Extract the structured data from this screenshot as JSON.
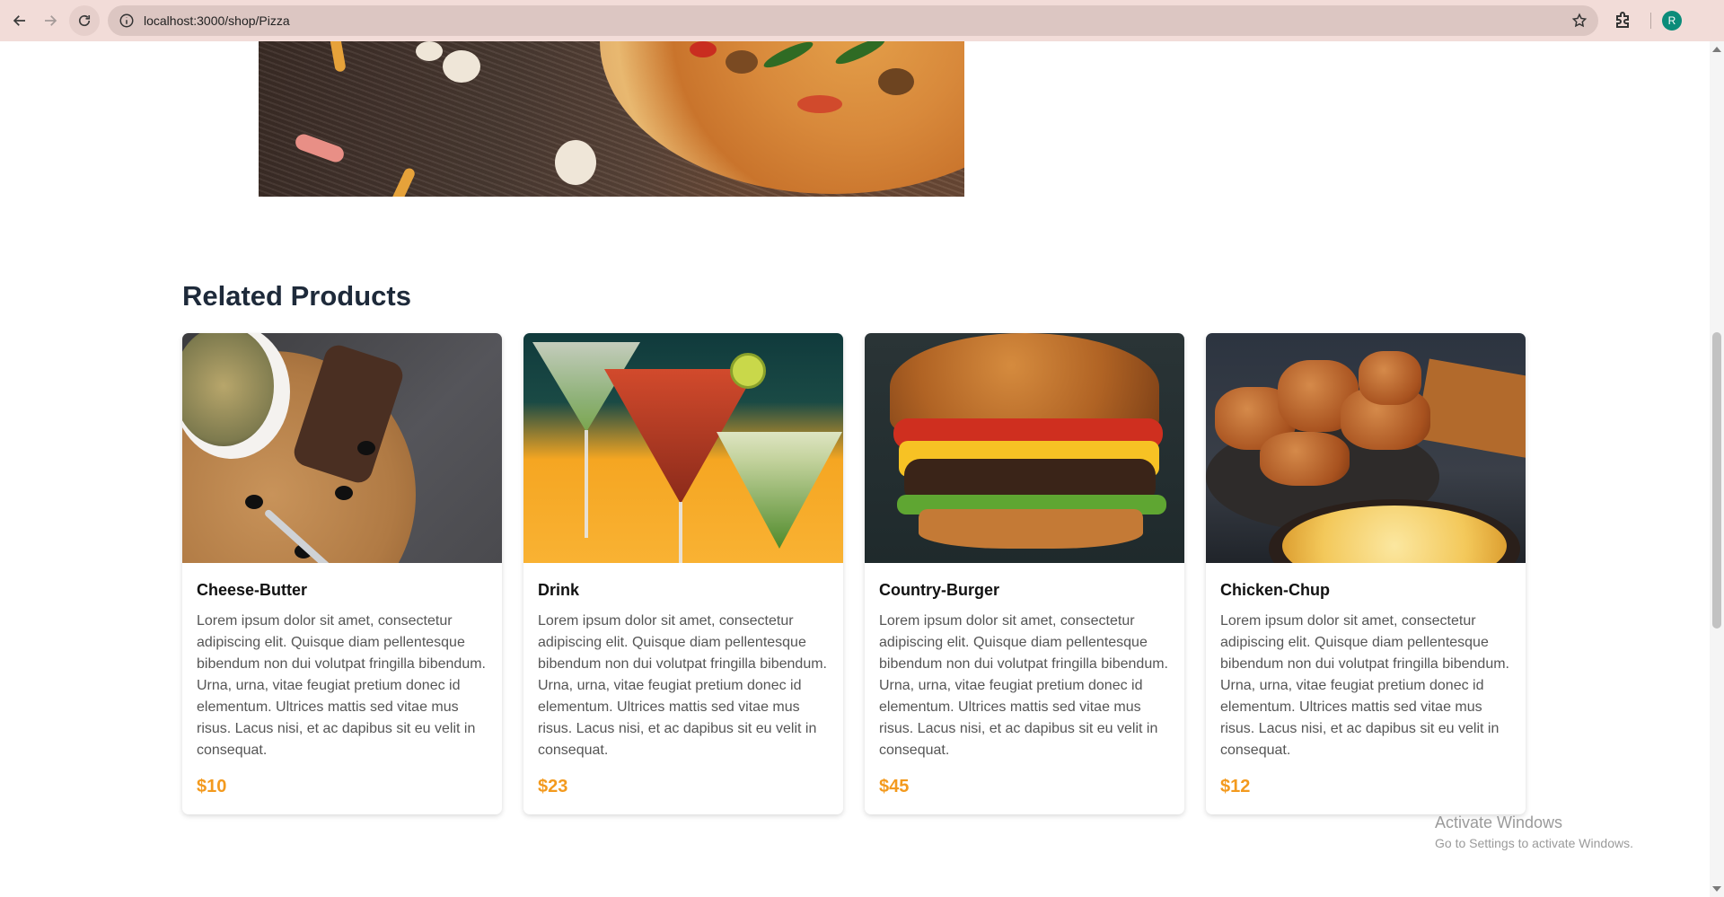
{
  "browser": {
    "url": "localhost:3000/shop/Pizza",
    "avatar_initial": "R",
    "avatar_color": "#0b8c7a"
  },
  "related": {
    "title": "Related Products",
    "products": [
      {
        "name": "Cheese-Butter",
        "description": "Lorem ipsum dolor sit amet, consectetur adipiscing elit. Quisque diam pellentesque bibendum non dui volutpat fringilla bibendum. Urna, urna, vitae feugiat pretium donec id elementum. Ultrices mattis sed vitae mus risus. Lacus nisi, et ac dapibus sit eu velit in consequat.",
        "price": "$10"
      },
      {
        "name": "Drink",
        "description": "Lorem ipsum dolor sit amet, consectetur adipiscing elit. Quisque diam pellentesque bibendum non dui volutpat fringilla bibendum. Urna, urna, vitae feugiat pretium donec id elementum. Ultrices mattis sed vitae mus risus. Lacus nisi, et ac dapibus sit eu velit in consequat.",
        "price": "$23"
      },
      {
        "name": "Country-Burger",
        "description": "Lorem ipsum dolor sit amet, consectetur adipiscing elit. Quisque diam pellentesque bibendum non dui volutpat fringilla bibendum. Urna, urna, vitae feugiat pretium donec id elementum. Ultrices mattis sed vitae mus risus. Lacus nisi, et ac dapibus sit eu velit in consequat.",
        "price": "$45"
      },
      {
        "name": "Chicken-Chup",
        "description": "Lorem ipsum dolor sit amet, consectetur adipiscing elit. Quisque diam pellentesque bibendum non dui volutpat fringilla bibendum. Urna, urna, vitae feugiat pretium donec id elementum. Ultrices mattis sed vitae mus risus. Lacus nisi, et ac dapibus sit eu velit in consequat.",
        "price": "$12"
      }
    ]
  },
  "colors": {
    "price": "#f39a1e",
    "heading": "#1e2a3a",
    "chrome": "#f2dcd8"
  },
  "watermark": {
    "title": "Activate Windows",
    "subtitle": "Go to Settings to activate Windows."
  }
}
